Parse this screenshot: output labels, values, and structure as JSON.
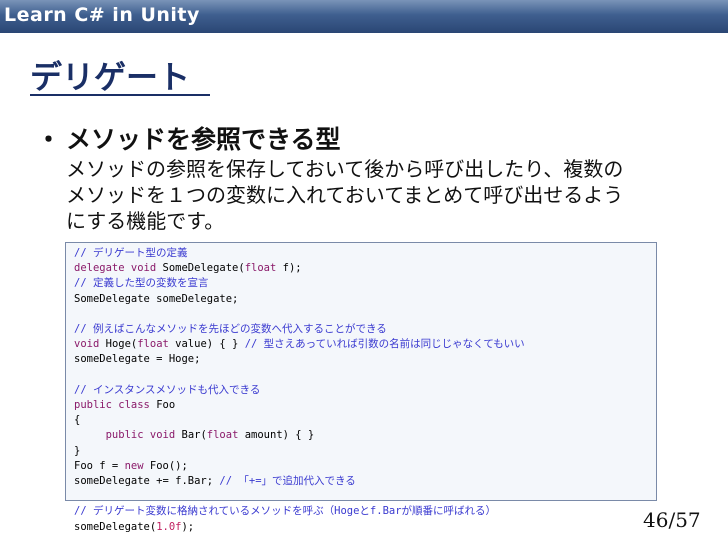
{
  "header": {
    "title": "Learn C# in Unity"
  },
  "slide": {
    "title": "デリゲート",
    "bullet_marker": "・",
    "bullet_heading": "メソッドを参照できる型",
    "body_lines": [
      "メソッドの参照を保存しておいて後から呼び出したり、複数の",
      "メソッドを１つの変数に入れておいてまとめて呼び出せるよう",
      "にする機能です。"
    ]
  },
  "code": {
    "lines": [
      [
        {
          "t": "// デリゲート型の定義",
          "c": "cm"
        }
      ],
      [
        {
          "t": "delegate",
          "c": "kw"
        },
        {
          "t": " "
        },
        {
          "t": "void",
          "c": "kw"
        },
        {
          "t": " SomeDelegate("
        },
        {
          "t": "float",
          "c": "kw"
        },
        {
          "t": " f);"
        }
      ],
      [
        {
          "t": "// 定義した型の変数を宣言",
          "c": "cm"
        }
      ],
      [
        {
          "t": "SomeDelegate someDelegate;"
        }
      ],
      [],
      [
        {
          "t": "// 例えばこんなメソッドを先ほどの変数へ代入することができる",
          "c": "cm"
        }
      ],
      [
        {
          "t": "void",
          "c": "kw"
        },
        {
          "t": " Hoge("
        },
        {
          "t": "float",
          "c": "kw"
        },
        {
          "t": " value) { } "
        },
        {
          "t": "// 型さえあっていれば引数の名前は同じじゃなくてもいい",
          "c": "cm"
        }
      ],
      [
        {
          "t": "someDelegate = Hoge;"
        }
      ],
      [],
      [
        {
          "t": "// インスタンスメソッドも代入できる",
          "c": "cm"
        }
      ],
      [
        {
          "t": "public",
          "c": "kw"
        },
        {
          "t": " "
        },
        {
          "t": "class",
          "c": "kw"
        },
        {
          "t": " Foo"
        }
      ],
      [
        {
          "t": "{"
        }
      ],
      [
        {
          "t": "     "
        },
        {
          "t": "public",
          "c": "kw"
        },
        {
          "t": " "
        },
        {
          "t": "void",
          "c": "kw"
        },
        {
          "t": " Bar("
        },
        {
          "t": "float",
          "c": "kw"
        },
        {
          "t": " amount) { }"
        }
      ],
      [
        {
          "t": "}"
        }
      ],
      [
        {
          "t": "Foo f = "
        },
        {
          "t": "new",
          "c": "kw"
        },
        {
          "t": " Foo();"
        }
      ],
      [
        {
          "t": "someDelegate += f.Bar; "
        },
        {
          "t": "// 「+=」で追加代入できる",
          "c": "cm"
        }
      ],
      [],
      [
        {
          "t": "// デリゲート変数に格納されているメソッドを呼ぶ（Hogeとf.Barが順番に呼ばれる）",
          "c": "cm"
        }
      ],
      [
        {
          "t": "someDelegate("
        },
        {
          "t": "1.0f",
          "c": "num"
        },
        {
          "t": ");"
        }
      ]
    ]
  },
  "footer": {
    "page": "46/57"
  }
}
